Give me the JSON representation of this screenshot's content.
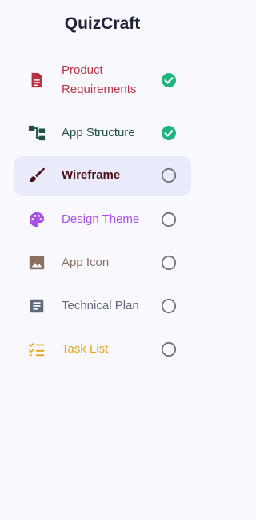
{
  "app": {
    "title": "QuizCraft"
  },
  "steps": [
    {
      "label": "Product Requirements",
      "label_lines": [
        "Product",
        "Requirements"
      ],
      "icon": "document-icon",
      "color": "#b83445",
      "status": "complete"
    },
    {
      "label": "App Structure",
      "icon": "sitemap-icon",
      "color": "#1f4f4a",
      "status": "complete"
    },
    {
      "label": "Wireframe",
      "icon": "brush-icon",
      "color": "#4a0e14",
      "status": "current"
    },
    {
      "label": "Design Theme",
      "icon": "palette-icon",
      "color": "#a94ee8",
      "status": "pending"
    },
    {
      "label": "App Icon",
      "icon": "image-icon",
      "color": "#8a6e5e",
      "status": "pending"
    },
    {
      "label": "Technical Plan",
      "icon": "article-icon",
      "color": "#5f6a7d",
      "status": "pending"
    },
    {
      "label": "Task List",
      "icon": "checklist-icon",
      "color": "#e8a512",
      "status": "pending"
    }
  ],
  "colors": {
    "complete": "#1fb57e",
    "pending_ring": "#6b7280",
    "active_bg": "#e9ebfb"
  }
}
